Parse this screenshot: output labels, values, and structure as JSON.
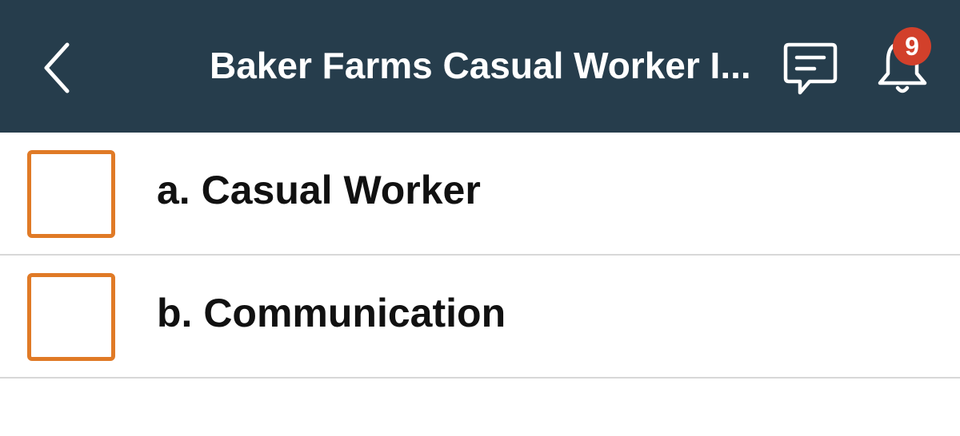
{
  "header": {
    "title": "Baker Farms Casual Worker I...",
    "back_icon": "chevron-left-icon",
    "chat_icon": "chat-bubble-icon",
    "bell_icon": "bell-icon",
    "notification_count": "9",
    "background_color": "#263d4c",
    "badge_color": "#d2402b"
  },
  "items": [
    {
      "label": "a. Casual Worker",
      "checked": false
    },
    {
      "label": "b. Communication",
      "checked": false
    }
  ],
  "colors": {
    "checkbox_border": "#e07a26",
    "divider": "#d8d8d8"
  }
}
